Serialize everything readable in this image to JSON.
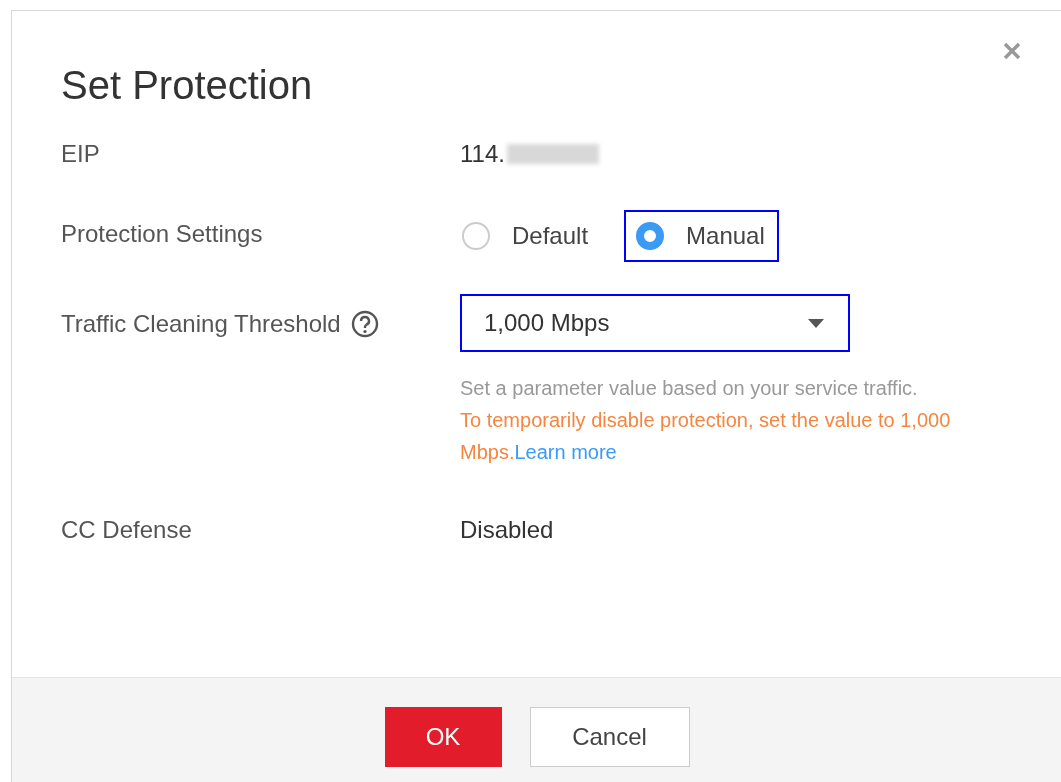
{
  "dialog": {
    "title": "Set Protection"
  },
  "fields": [
    {
      "kind": "text",
      "label": "EIP",
      "value": "114.",
      "redacted": true
    },
    {
      "kind": "radio",
      "label": "Protection Settings",
      "options": [
        {
          "label": "Default",
          "selected": false,
          "highlighted": false
        },
        {
          "label": "Manual",
          "selected": true,
          "highlighted": true
        }
      ]
    },
    {
      "kind": "select",
      "label": "Traffic Cleaning Threshold",
      "help": true,
      "value": "1,000 Mbps",
      "highlighted": true,
      "hint": "Set a parameter value based on your service traffic.",
      "warning": "To temporarily disable protection, set the value to 1,000 Mbps.",
      "link": "Learn more"
    },
    {
      "kind": "text",
      "label": "CC Defense",
      "value": "Disabled",
      "redacted": false
    }
  ],
  "buttons": [
    {
      "label": "OK",
      "primary": true
    },
    {
      "label": "Cancel",
      "primary": false
    }
  ]
}
